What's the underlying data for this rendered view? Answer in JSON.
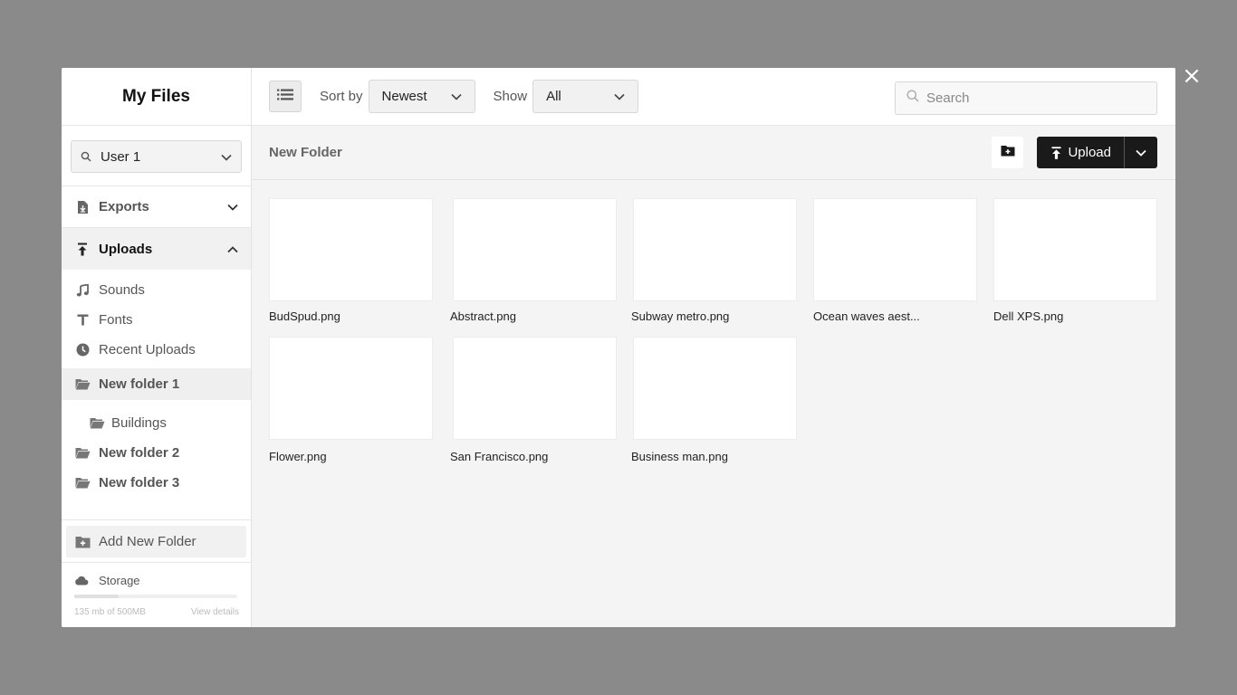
{
  "close_icon_label": "×",
  "sidebar": {
    "title": "My Files",
    "user_select": {
      "value": "User 1"
    },
    "exports": {
      "label": "Exports"
    },
    "uploads": {
      "label": "Uploads"
    },
    "sub_items": [
      {
        "label": "Sounds",
        "icon": "music-note-icon"
      },
      {
        "label": "Fonts",
        "icon": "font-icon"
      },
      {
        "label": "Recent Uploads",
        "icon": "clock-icon"
      }
    ],
    "folders": {
      "folder1": "New folder 1",
      "child": "Buildings",
      "folder2": "New folder 2",
      "folder3": "New folder 3"
    },
    "add_folder": "Add New Folder",
    "storage": {
      "label": "Storage",
      "usage": "135 mb of 500MB",
      "used_fraction": 0.27,
      "details": "View details"
    }
  },
  "toolbar": {
    "sort_label": "Sort by",
    "sort_value": "Newest",
    "show_label": "Show",
    "show_value": "All",
    "search_placeholder": "Search"
  },
  "folder_bar": {
    "title": "New Folder",
    "upload_label": "Upload"
  },
  "files": [
    "BudSpud.png",
    "Abstract.png",
    "Subway metro.png",
    "Ocean waves aest...",
    "Dell XPS.png",
    "Flower.png",
    "San Francisco.png",
    "Business man.png"
  ]
}
